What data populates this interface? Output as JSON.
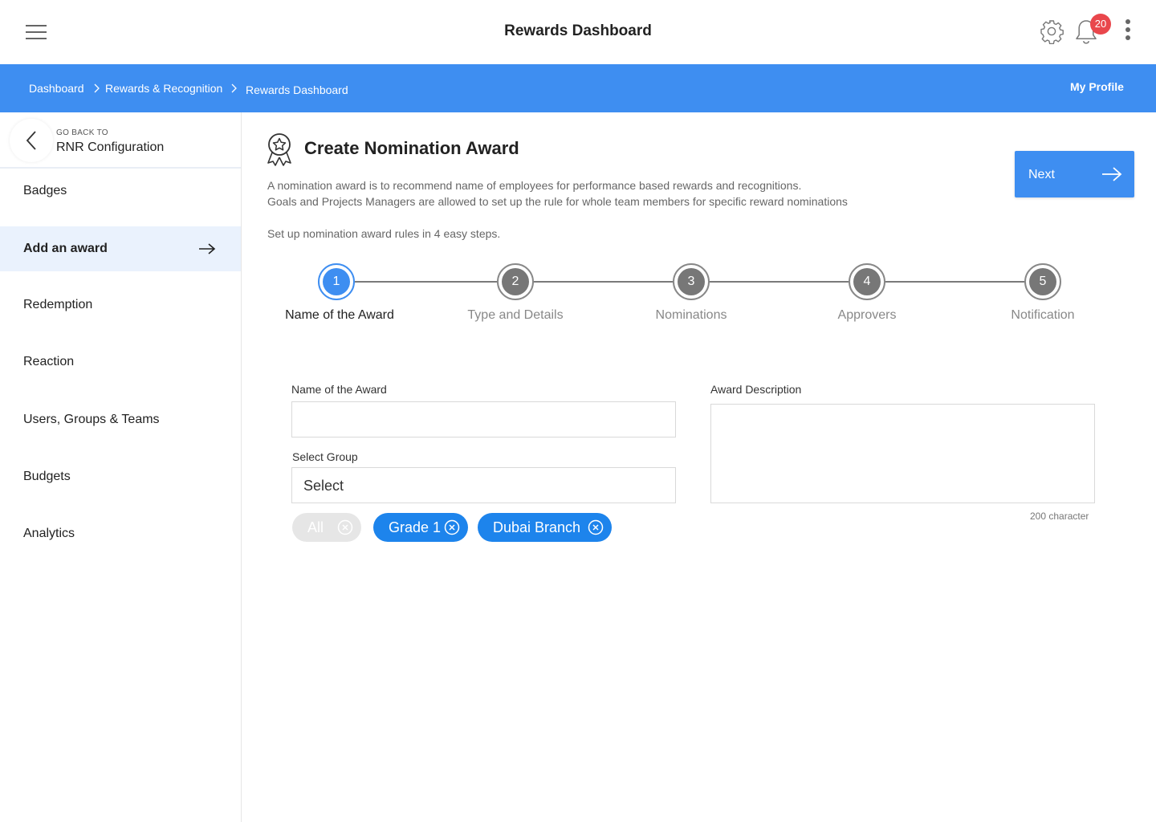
{
  "header": {
    "title": "Rewards Dashboard",
    "notification_count": "20"
  },
  "breadcrumb": {
    "items": [
      "Dashboard",
      "Rewards & Recognition",
      "Rewards Dashboard"
    ],
    "profile_link": "My Profile"
  },
  "sidebar": {
    "back_small": "GO BACK TO",
    "back_main": "RNR Configuration",
    "items": [
      {
        "label": "Badges"
      },
      {
        "label": "Add an award"
      },
      {
        "label": "Redemption"
      },
      {
        "label": "Reaction"
      },
      {
        "label": "Users, Groups & Teams"
      },
      {
        "label": "Budgets"
      },
      {
        "label": "Analytics"
      }
    ],
    "active_index": 1
  },
  "main": {
    "title": "Create Nomination Award",
    "desc_line1": "A nomination award is to recommend name of employees for performance based rewards and recognitions.",
    "desc_line2": "Goals and Projects Managers are allowed to set up the rule for whole team members for specific reward nominations",
    "steps_intro": "Set up nomination award rules in 4 easy steps.",
    "next_label": "Next",
    "steps": [
      {
        "num": "1",
        "label": "Name of the Award"
      },
      {
        "num": "2",
        "label": "Type and Details"
      },
      {
        "num": "3",
        "label": "Nominations"
      },
      {
        "num": "4",
        "label": "Approvers"
      },
      {
        "num": "5",
        "label": "Notification"
      }
    ],
    "active_step": 1
  },
  "form": {
    "award_name_label": "Name of the Award",
    "award_name_value": "",
    "group_label": "Select Group",
    "group_value": "Select",
    "description_label": "Award Description",
    "description_value": "",
    "char_hint": "200 character",
    "chips": [
      {
        "label": "All",
        "disabled": true
      },
      {
        "label": "Grade 1",
        "disabled": false
      },
      {
        "label": "Dubai Branch",
        "disabled": false
      }
    ]
  },
  "colors": {
    "accent": "#3e8ef1",
    "chip": "#1d84ec",
    "badge": "#e9474c"
  }
}
